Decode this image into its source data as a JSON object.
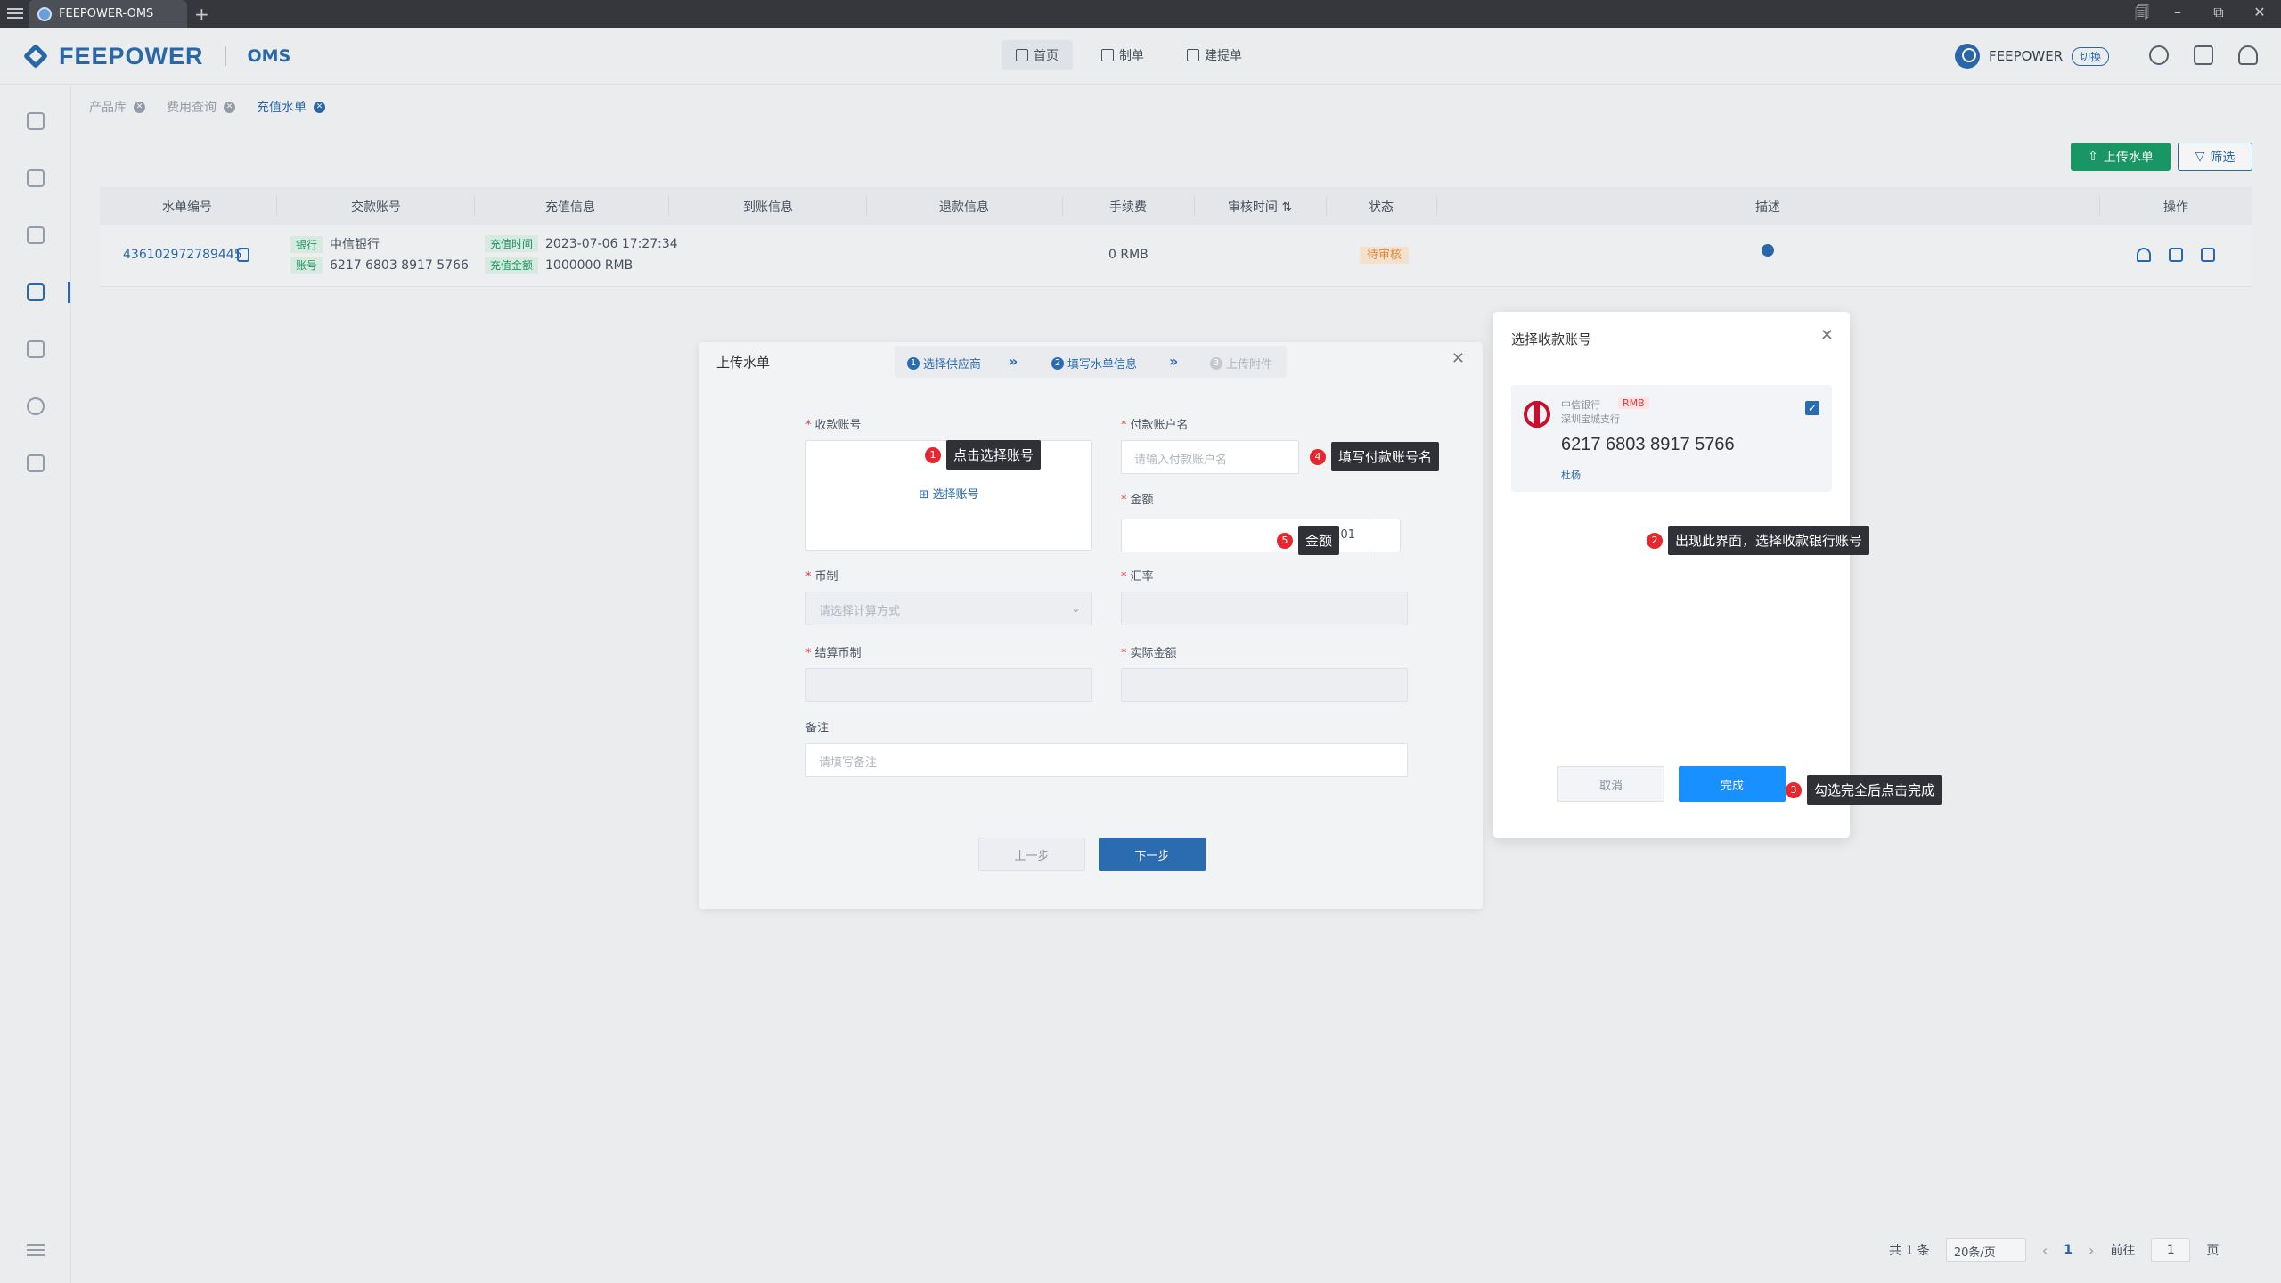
{
  "titlebar": {
    "tab_title": "FEEPOWER-OMS",
    "new_tab": "+",
    "controls": [
      "🗐",
      "–",
      "⧉",
      "✕"
    ]
  },
  "header": {
    "brand": "FEEPOWER",
    "product": "OMS",
    "nav": [
      {
        "label": "首页",
        "icon": "grid-icon"
      },
      {
        "label": "制单",
        "icon": "user-icon"
      },
      {
        "label": "建提单",
        "icon": "doc-icon"
      }
    ],
    "user_name": "FEEPOWER",
    "switch_label": "切换"
  },
  "breadcrumbs": [
    {
      "label": "产品库"
    },
    {
      "label": "费用查询"
    },
    {
      "label": "充值水单"
    }
  ],
  "toolbar": {
    "upload_label": "上传水单",
    "filter_label": "筛选"
  },
  "table": {
    "headers": [
      "水单编号",
      "交款账号",
      "充值信息",
      "到账信息",
      "退款信息",
      "手续费",
      "审核时间 ⇅",
      "状态",
      "描述",
      "操作"
    ],
    "row": {
      "id": "436102972789445",
      "bank_tag": "银行",
      "bank": "中信银行",
      "account_tag": "账号",
      "account": "6217 6803 8917 5766",
      "time_tag": "充值时间",
      "time": "2023-07-06 17:27:34",
      "amount_tag": "充值金额",
      "amount": "1000000 RMB",
      "fee": "0 RMB",
      "status": "待审核"
    }
  },
  "pager": {
    "total": "共 1 条",
    "page_size": "20条/页",
    "page": "1",
    "goto_label": "前往",
    "goto_value": "1",
    "page_suffix": "页"
  },
  "upload_dialog": {
    "title": "上传水单",
    "steps": [
      {
        "num": "1",
        "label": "选择供应商"
      },
      {
        "num": "2",
        "label": "填写水单信息"
      },
      {
        "num": "3",
        "label": "上传附件"
      }
    ],
    "receive_account_label": "收款账号",
    "select_account": "选择账号",
    "payer_name_label": "付款账户名",
    "payer_name_placeholder": "请输入付款账户名",
    "amount_label": "金额",
    "amount_value": "0.01",
    "currency_label": "币制",
    "currency_placeholder": "请选择计算方式",
    "rate_label": "汇率",
    "settle_currency_label": "结算币制",
    "actual_amount_label": "实际金额",
    "remark_label": "备注",
    "remark_placeholder": "请填写备注",
    "prev_label": "上一步",
    "next_label": "下一步"
  },
  "account_dialog": {
    "title": "选择收款账号",
    "bank": "中信银行",
    "currency": "RMB",
    "branch": "深圳宝城支行",
    "account_number": "6217 6803 8917 5766",
    "holder": "杜杨",
    "cancel_label": "取消",
    "done_label": "完成"
  },
  "callouts": [
    {
      "num": "1",
      "text": "点击选择账号"
    },
    {
      "num": "2",
      "text": "出现此界面，选择收款银行账号"
    },
    {
      "num": "3",
      "text": "勾选完全后点击完成"
    },
    {
      "num": "4",
      "text": "填写付款账号名"
    },
    {
      "num": "5",
      "text": "金额"
    }
  ],
  "colors": {
    "primary": "#2b6cb0",
    "upload_green": "#1a9e6a",
    "done_blue": "#1890ff",
    "status_orange": "#e7903b",
    "callout_red": "#e8262e"
  }
}
